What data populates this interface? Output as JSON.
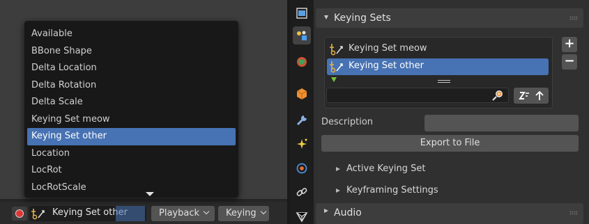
{
  "menu": {
    "items": [
      "Available",
      "BBone Shape",
      "Delta Location",
      "Delta Rotation",
      "Delta Scale",
      "Keying Set meow",
      "Keying Set other",
      "Location",
      "LocRot",
      "LocRotScale"
    ],
    "active_item": "Keying Set other"
  },
  "timeline_header": {
    "active_keying_set": "Keying Set other",
    "playback_label": "Playback",
    "keying_label": "Keying"
  },
  "properties": {
    "keying_sets_panel": {
      "title": "Keying Sets",
      "list": [
        {
          "label": "Keying Set meow",
          "active": false
        },
        {
          "label": "Keying Set other",
          "active": true
        }
      ],
      "filter_value": "",
      "add_label": "+",
      "remove_label": "−"
    },
    "description_label": "Description",
    "description_value": "",
    "export_button": "Export to File",
    "subpanels": [
      "Active Keying Set",
      "Keyframing Settings"
    ],
    "audio_panel_title": "Audio"
  },
  "colors": {
    "accent": "#4772b3",
    "record": "#e03535",
    "panel_bg": "#303030"
  },
  "icons": {
    "tabs": [
      "render-icon",
      "scene-icon",
      "world-icon",
      "object-icon",
      "modifier-icon",
      "particles-icon",
      "physics-icon",
      "constraints-icon",
      "data-icon"
    ],
    "keying_set": "keyingset-icon"
  }
}
